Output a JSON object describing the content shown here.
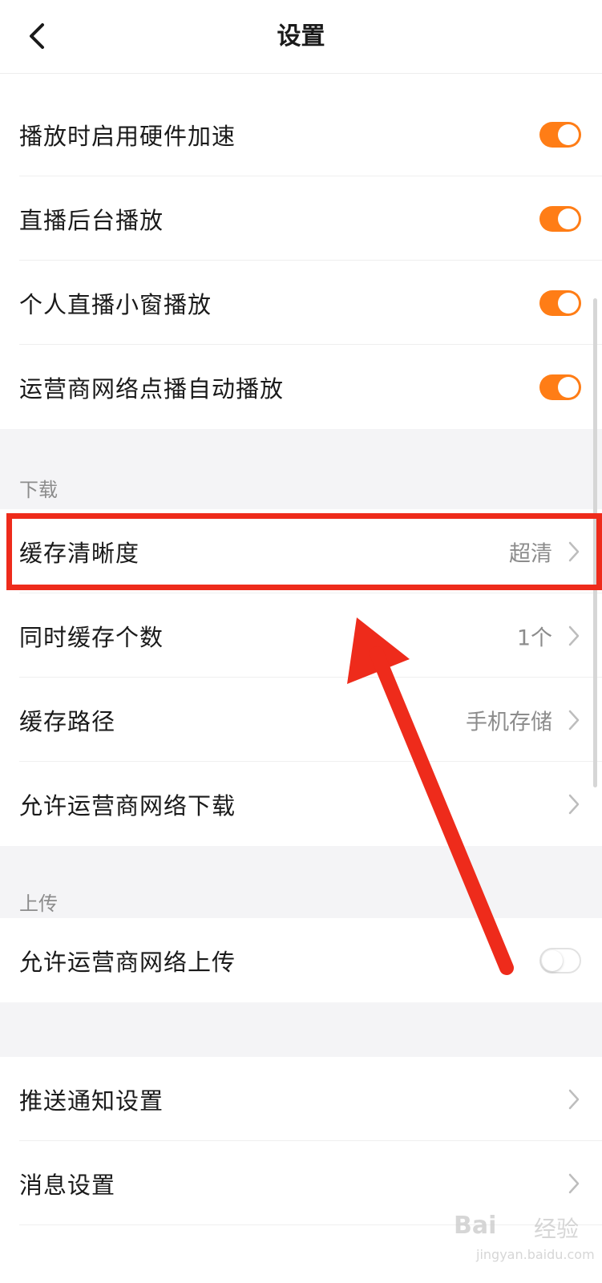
{
  "header": {
    "title": "设置",
    "back_icon": "chevron-left-icon"
  },
  "playback": {
    "items": [
      {
        "label": "播放时启用硬件加速",
        "toggle": true
      },
      {
        "label": "直播后台播放",
        "toggle": true
      },
      {
        "label": "个人直播小窗播放",
        "toggle": true
      },
      {
        "label": "运营商网络点播自动播放",
        "toggle": true
      }
    ]
  },
  "download": {
    "title": "下载",
    "items": [
      {
        "label": "缓存清晰度",
        "value": "超清"
      },
      {
        "label": "同时缓存个数",
        "value": "1个"
      },
      {
        "label": "缓存路径",
        "value": "手机存储"
      },
      {
        "label": "允许运营商网络下载",
        "value": ""
      }
    ]
  },
  "upload": {
    "title": "上传",
    "items": [
      {
        "label": "允许运营商网络上传",
        "toggle": false
      }
    ]
  },
  "general": {
    "items": [
      {
        "label": "推送通知设置"
      },
      {
        "label": "消息设置"
      }
    ]
  },
  "colors": {
    "accent": "#ff7d16",
    "highlight": "#ee2b1b",
    "section_bg": "#f4f4f6"
  },
  "watermark": {
    "logo": "Bai",
    "text": "经验",
    "url": "jingyan.baidu.com"
  }
}
